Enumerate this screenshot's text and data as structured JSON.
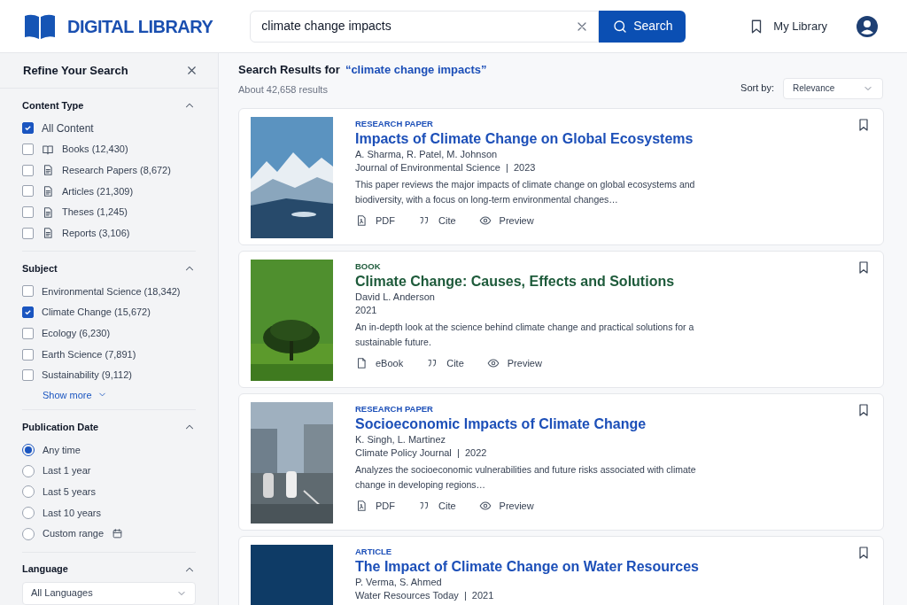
{
  "header": {
    "logo_text": "DIGITAL LIBRARY",
    "search": {
      "value": "climate change impacts"
    },
    "search_button": "Search",
    "my_library": "My Library"
  },
  "sidebar": {
    "title": "Refine Your Search",
    "sections": [
      {
        "title": "Content Type",
        "expanded": true,
        "kind": "checkbox",
        "items": [
          {
            "label": "All Content",
            "kind": "plain",
            "checked": true
          },
          {
            "label": "Books (12,430)",
            "kind": "book",
            "checked": false
          },
          {
            "label": "Research Papers (8,672)",
            "kind": "document",
            "checked": false
          },
          {
            "label": "Articles (21,309)",
            "kind": "document",
            "checked": false
          },
          {
            "label": "Theses (1,245)",
            "kind": "document",
            "checked": false
          },
          {
            "label": "Reports (3,106)",
            "kind": "document",
            "checked": false
          }
        ]
      },
      {
        "title": "Subject",
        "expanded": true,
        "kind": "checkbox",
        "more": "Show more",
        "items": [
          {
            "label": "Environmental Science (18,342)",
            "kind": "plain",
            "checked": false
          },
          {
            "label": "Climate Change (15,672)",
            "kind": "plain",
            "checked": true
          },
          {
            "label": "Ecology (6,230)",
            "kind": "plain",
            "checked": false
          },
          {
            "label": "Earth Science (7,891)",
            "kind": "plain",
            "checked": false
          },
          {
            "label": "Sustainability (9,112)",
            "kind": "plain",
            "checked": false
          }
        ]
      },
      {
        "title": "Publication Date",
        "expanded": true,
        "kind": "radio",
        "items": [
          {
            "label": "Any time",
            "kind": "plain",
            "selected": true
          },
          {
            "label": "Last 1 year",
            "kind": "plain",
            "selected": false
          },
          {
            "label": "Last 5 years",
            "kind": "plain",
            "selected": false
          },
          {
            "label": "Last 10 years",
            "kind": "plain",
            "selected": false
          },
          {
            "label": "Custom range",
            "kind": "calendar",
            "selected": false
          }
        ]
      },
      {
        "title": "Language",
        "expanded": true,
        "kind": "select",
        "value": "All Languages"
      }
    ]
  },
  "results_header": {
    "prefix": "Search Results for",
    "query": "“climate change impacts”",
    "count": "About 42,658 results",
    "sort_label": "Sort by:",
    "sort_value": "Relevance"
  },
  "results": [
    {
      "type": "RESEARCH PAPER",
      "color": "#1c4fb8",
      "title": "Impacts of Climate Change on Global Ecosystems",
      "authors": "A. Sharma, R. Patel, M. Johnson",
      "source": "Journal of Environmental Science  |  2023",
      "abstract": "This paper reviews the major impacts of climate change on global ecosystems and biodiversity, with a focus on long-term environmental changes…",
      "actions": [
        {
          "kind": "pdf",
          "label": "PDF"
        },
        {
          "kind": "cite",
          "label": "Cite"
        },
        {
          "kind": "preview",
          "label": "Preview"
        }
      ]
    },
    {
      "type": "BOOK",
      "color": "#1d5a3a",
      "title": "Climate Change: Causes, Effects and Solutions",
      "authors": "David L. Anderson",
      "source": "2021",
      "abstract": "An in-depth look at the science behind climate change and practical solutions for a sustainable future.",
      "actions": [
        {
          "kind": "ebook",
          "label": "eBook"
        },
        {
          "kind": "cite",
          "label": "Cite"
        },
        {
          "kind": "preview",
          "label": "Preview"
        }
      ]
    },
    {
      "type": "RESEARCH PAPER",
      "color": "#1c4fb8",
      "title": "Socioeconomic Impacts of Climate Change",
      "authors": "K. Singh, L. Martinez",
      "source": "Climate Policy Journal  |  2022",
      "abstract": "Analyzes the socioeconomic vulnerabilities and future risks associated with climate change in developing regions…",
      "actions": [
        {
          "kind": "pdf",
          "label": "PDF"
        },
        {
          "kind": "cite",
          "label": "Cite"
        },
        {
          "kind": "preview",
          "label": "Preview"
        }
      ]
    },
    {
      "type": "ARTICLE",
      "color": "#1c4fb8",
      "title": "The Impact of Climate Change on Water Resources",
      "authors": "P. Verma, S. Ahmed",
      "source": "Water Resources Today  |  2021"
    }
  ]
}
